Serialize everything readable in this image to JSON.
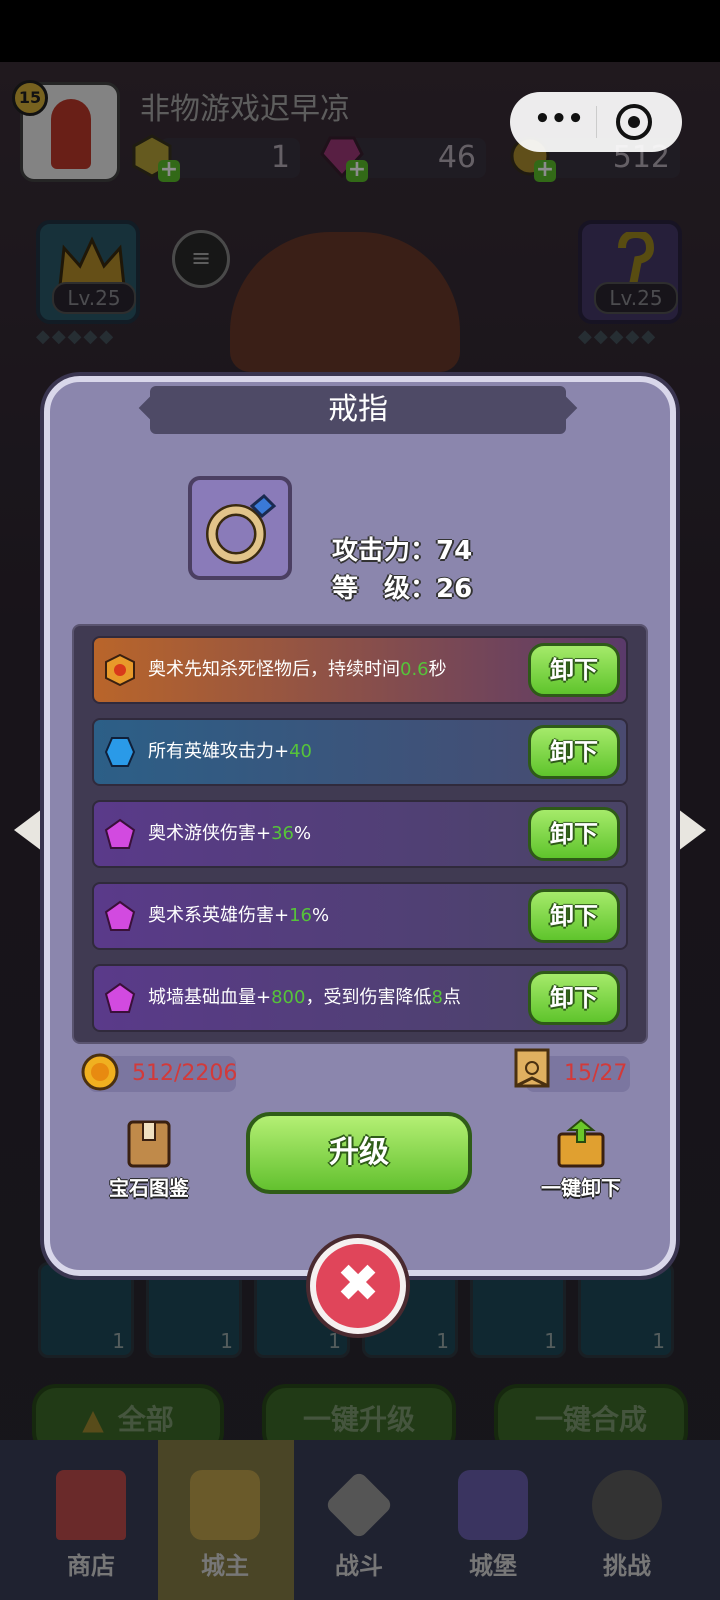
{
  "header": {
    "player_level": "15",
    "player_name": "非物游戏迟早凉",
    "resources": [
      {
        "icon": "gold-crystal-icon",
        "value": "1"
      },
      {
        "icon": "pink-gem-icon",
        "value": "46"
      },
      {
        "icon": "gold-coin-icon",
        "value": "512"
      }
    ]
  },
  "side_cards": {
    "left": {
      "icon": "crown-icon",
      "level": "Lv.25"
    },
    "right": {
      "icon": "staff-icon",
      "level": "Lv.25"
    }
  },
  "modal": {
    "title": "戒指",
    "item_icon": "ring-icon",
    "stats": [
      {
        "label": "攻击力：",
        "value": "74"
      },
      {
        "label": "等　级：",
        "value": "26"
      }
    ],
    "gems": [
      {
        "icon": "orange-hex-gem-icon",
        "text_a": "奥术先知杀死怪物后，持续时间",
        "num1": "0.6",
        "text_b": "秒",
        "num2": "",
        "text_c": "",
        "button": "卸下",
        "bg": "#b9652a"
      },
      {
        "icon": "blue-gem-icon",
        "text_a": "所有英雄攻击力+",
        "num1": "40",
        "text_b": "",
        "num2": "",
        "text_c": "",
        "button": "卸下",
        "bg": "#2c5f87"
      },
      {
        "icon": "purple-gem-icon",
        "text_a": "奥术游侠伤害+",
        "num1": "36",
        "text_b": "%",
        "num2": "",
        "text_c": "",
        "button": "卸下",
        "bg": "#5a3a8a"
      },
      {
        "icon": "purple-gem-icon",
        "text_a": "奥术系英雄伤害+",
        "num1": "16",
        "text_b": "%",
        "num2": "",
        "text_c": "",
        "button": "卸下",
        "bg": "#5a3a8a"
      },
      {
        "icon": "purple-gem-icon",
        "text_a": "城墙基础血量+",
        "num1": "800",
        "text_b": "，受到伤害降低",
        "num2": "8",
        "text_c": "点",
        "button": "卸下",
        "bg": "#5a3a8a"
      }
    ],
    "coin_cost": "512/2206",
    "scroll_cost": "15/27",
    "gem_catalog_label": "宝石图鉴",
    "upgrade_label": "升级",
    "unequip_all_label": "一键卸下"
  },
  "bottom_buttons": {
    "all": "全部",
    "upgrade_all": "一键升级",
    "merge_all": "一键合成"
  },
  "slots": [
    "1",
    "1",
    "1",
    "1",
    "1",
    "1"
  ],
  "nav": [
    {
      "label": "商店",
      "icon": "shop-icon"
    },
    {
      "label": "城主",
      "icon": "crown-nav-icon"
    },
    {
      "label": "战斗",
      "icon": "swords-icon"
    },
    {
      "label": "城堡",
      "icon": "castle-icon"
    },
    {
      "label": "挑战",
      "icon": "challenge-icon"
    }
  ],
  "colors": {
    "green_text": "#56c33a",
    "cost_red": "#d23a3a",
    "modal_bg": "#8b86ad"
  }
}
